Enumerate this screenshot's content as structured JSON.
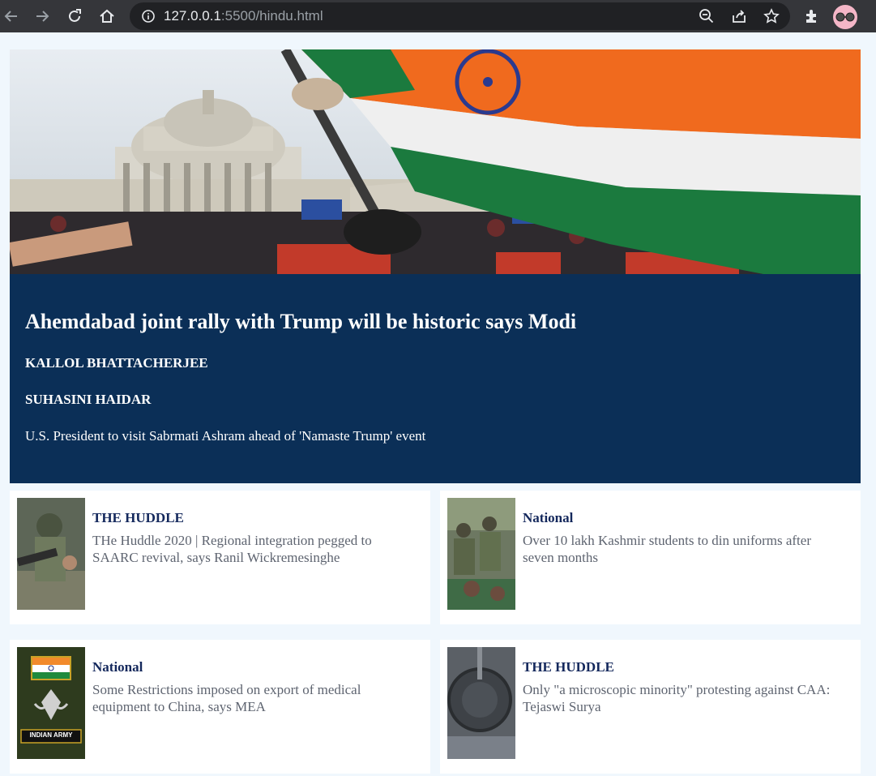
{
  "browser": {
    "url_host": "127.0.0.1",
    "url_rest": ":5500/hindu.html",
    "back_icon": "back-arrow-icon",
    "forward_icon": "forward-arrow-icon",
    "reload_icon": "reload-icon",
    "home_icon": "home-icon"
  },
  "hero": {
    "image": "capitol-rally-indian-flag-photo",
    "headline": "Ahemdabad joint rally with Trump will be historic says Modi",
    "authors": [
      "KALLOL BHATTACHERJEE",
      "SUHASINI HAIDAR"
    ],
    "summary": "U.S. President to visit Sabrmati Ashram ahead of 'Namaste Trump' event",
    "panel_color": "#0b2f57"
  },
  "cards": [
    {
      "category": "THE HUDDLE",
      "text": "THe Huddle 2020 | Regional integration pegged to SAARC revival, says Ranil Wickremesinghe",
      "thumb": "soldier-photo"
    },
    {
      "category": "National",
      "text": "Over 10 lakh Kashmir students to din uniforms after seven months",
      "thumb": "soldiers-group-photo"
    },
    {
      "category": "National",
      "text": "Some Restrictions imposed on export of medical equipment to China, says MEA",
      "thumb": "indian-army-emblem",
      "thumb_label": "INDIAN ARMY"
    },
    {
      "category": "THE HUDDLE",
      "text": "Only \"a microscopic minority\" protesting against CAA: Tejaswi Surya",
      "thumb": "dark-emblem-photo"
    }
  ],
  "colors": {
    "category": "#14285c",
    "card_text": "#5e6470",
    "page_bg": "#f0f7fd"
  }
}
